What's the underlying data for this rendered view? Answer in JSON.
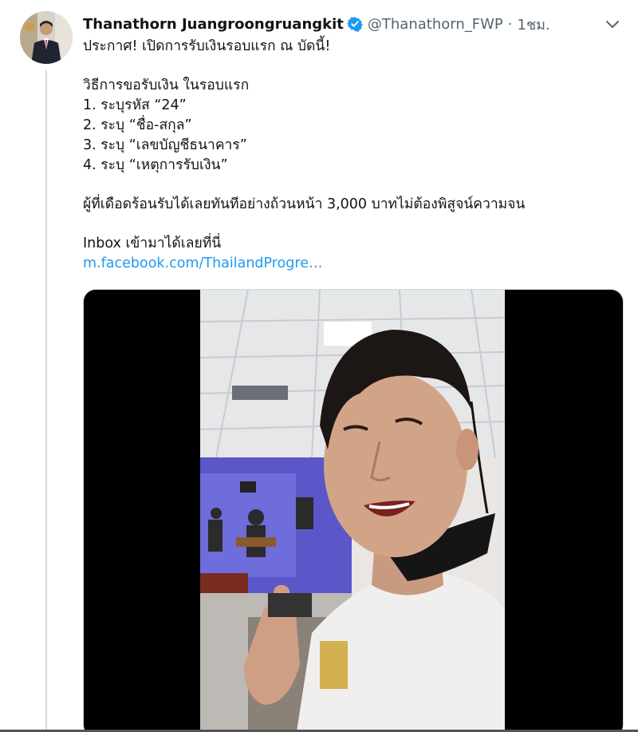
{
  "tweet": {
    "author_name": "Thanathorn Juangroongruangkit",
    "handle": "@Thanathorn_FWP",
    "separator": "·",
    "time": "1ชม.",
    "lines": [
      "ประกาศ! เปิดการรับเงินรอบแรก ณ บัดนี้!",
      "",
      "วิธีการขอรับเงิน  ในรอบแรก",
      "1. ระบุรหัส “24”",
      "2. ระบุ “ชื่อ-สกุล”",
      "3. ระบุ “เลขบัญชีธนาคาร”",
      "4. ระบุ “เหตุการรับเงิน”",
      "",
      "ผู้ที่เดือดร้อนรับได้เลยทันทีอย่างถ้วนหน้า 3,000 บาทไม่ต้องพิสูจน์ความจน",
      "",
      "Inbox เข้ามาได้เลยที่นี่"
    ],
    "link_text": "m.facebook.com/ThailandProgre…"
  },
  "icons": {
    "verified": "verified-badge-icon",
    "more": "chevron-down-icon"
  },
  "colors": {
    "name": "#0f1419",
    "secondary": "#536471",
    "link": "#1d9bf0",
    "verified": "#1d9bf0",
    "thread_line": "#cfd9de",
    "media_background": "#000000"
  }
}
